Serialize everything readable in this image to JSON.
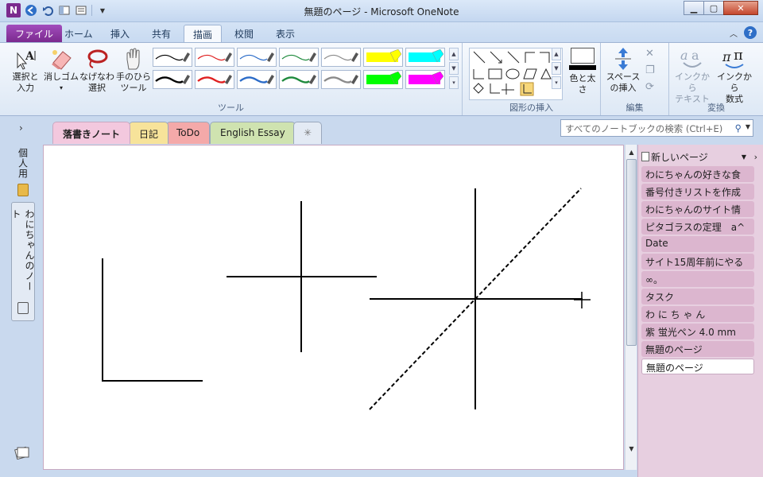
{
  "window": {
    "title": "無題のページ  -  Microsoft OneNote",
    "app_icon_letter": "N"
  },
  "ribbon_tabs": [
    {
      "label": "ファイル",
      "key": "file"
    },
    {
      "label": "ホーム",
      "key": "home"
    },
    {
      "label": "挿入",
      "key": "insert"
    },
    {
      "label": "共有",
      "key": "share"
    },
    {
      "label": "描画",
      "key": "draw"
    },
    {
      "label": "校閲",
      "key": "review"
    },
    {
      "label": "表示",
      "key": "view"
    }
  ],
  "ribbon": {
    "select_label_1": "選択と",
    "select_label_2": "入力",
    "eraser_label": "消しゴム",
    "lasso_label_1": "なげなわ",
    "lasso_label_2": "選択",
    "pan_label_1": "手のひら",
    "pan_label_2": "ツール",
    "tools_group": "ツール",
    "color_label": "色と太さ",
    "shapes_group": "図形の挿入",
    "space_label_1": "スペース",
    "space_label_2": "の挿入",
    "edit_group": "編集",
    "ink_text_label_1": "インクから",
    "ink_text_label_2": "テキスト",
    "ink_math_label_1": "インクから",
    "ink_math_label_2": "数式",
    "convert_group": "変換"
  },
  "pen_colors": [
    "#000000",
    "#e02020",
    "#2a6bc8",
    "#1e8a3c",
    "#8a8a8a",
    "#ffff00",
    "#00ffff",
    "#000000",
    "#e02020",
    "#2a6bc8",
    "#1e8a3c",
    "#8a8a8a",
    "#00ff00",
    "#ff00ff"
  ],
  "notebooks": [
    {
      "label": "個人用"
    },
    {
      "label": "わにちゃんのノート"
    }
  ],
  "section_tabs": [
    {
      "label": "落書きノート",
      "color": "#f3c8de"
    },
    {
      "label": "日記",
      "color": "#f7e39a"
    },
    {
      "label": "ToDo",
      "color": "#f4a9a9"
    },
    {
      "label": "English Essay",
      "color": "#cfe3b0"
    },
    {
      "label": "✳",
      "color": "#e3eaf4"
    }
  ],
  "search": {
    "placeholder": "すべてのノートブックの検索 (Ctrl+E)"
  },
  "page_panel": {
    "new_page": "新しいページ",
    "pages": [
      "わにちゃんの好きな食",
      "番号付きリストを作成",
      "わにちゃんのサイト情",
      "ピタゴラスの定理　a^",
      "Date",
      "サイト15周年前にやる",
      "∞。",
      "タスク",
      "わ に ち ゃ ん",
      "紫 蛍光ペン 4.0 mm",
      "無題のページ",
      "無題のページ"
    ],
    "selected_index": 11
  }
}
